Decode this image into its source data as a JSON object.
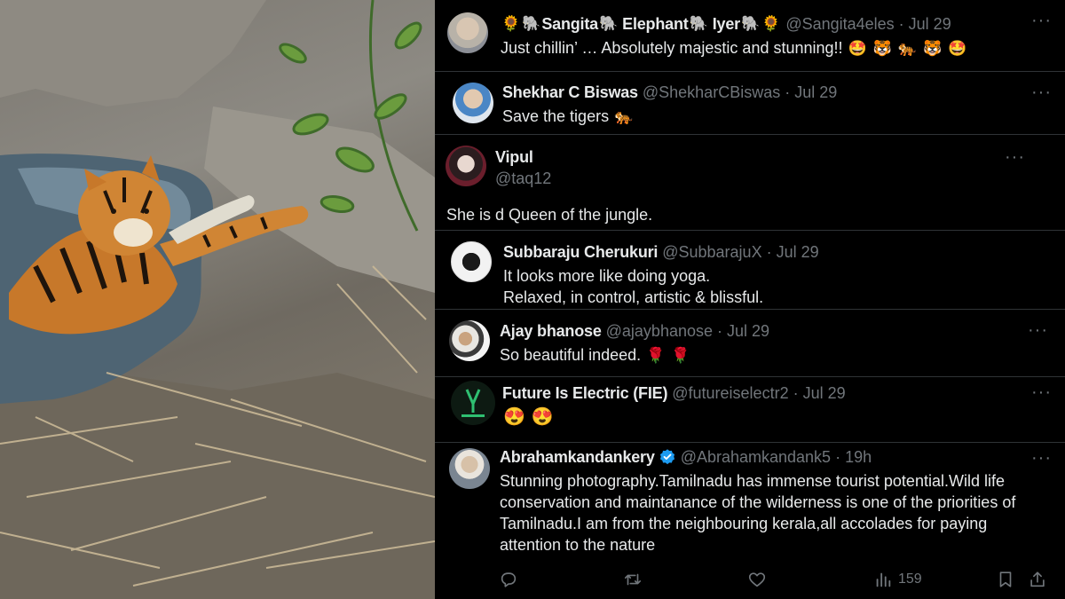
{
  "photo": {
    "subject": "tiger-in-waterhole"
  },
  "replies": [
    {
      "name_parts": [
        "Sangita",
        "Elephant",
        "Iyer"
      ],
      "name_emoji": [
        "🌻",
        "🐘",
        "🐘",
        "🐘",
        "🐘",
        "🌻"
      ],
      "handle": "@Sangita4eles",
      "time": "Jul 29",
      "text": "Just chillin’ … Absolutely majestic and stunning!!",
      "emoji": [
        "🤩",
        "🐯",
        "🐅",
        "🐯",
        "🤩"
      ]
    },
    {
      "name": "Shekhar C Biswas",
      "handle": "@ShekharCBiswas",
      "time": "Jul 29",
      "text": "Save the tigers",
      "emoji": [
        "🐅"
      ]
    },
    {
      "name": "Vipul",
      "handle": "@taq12",
      "text": "She is d Queen of the jungle."
    },
    {
      "name": "Subbaraju Cherukuri",
      "handle": "@SubbarajuX",
      "time": "Jul 29",
      "lines": [
        "It looks more like doing yoga.",
        "Relaxed, in control, artistic & blissful."
      ]
    },
    {
      "name": "Ajay bhanose",
      "handle": "@ajaybhanose",
      "time": "Jul 29",
      "text": "So beautiful indeed.",
      "emoji": [
        "🌹",
        "🌹"
      ]
    },
    {
      "name": "Future Is Electric (FIE)",
      "handle": "@futureiselectr2",
      "time": "Jul 29",
      "emoji": [
        "😍",
        "😍"
      ]
    },
    {
      "name": "Abrahamkandankery",
      "handle": "@Abrahamkandank5",
      "time": "19h",
      "lines": [
        "Stunning photography.Tamilnadu has immense tourist potential.Wild life",
        "conservation and maintanance of the wilderness is one of the priorities of",
        "Tamilnadu.I am from the neighbouring kerala,all accolades for paying",
        "attention to the nature"
      ]
    }
  ],
  "actions": {
    "views": "159"
  },
  "time_sep": "·",
  "more_glyph": "···",
  "colors": {
    "background": "#000000",
    "text": "#e7e9ea",
    "muted": "#71767b",
    "divider": "#2f3336",
    "verified": "#1d9bf0"
  },
  "icons": [
    "reply-icon",
    "retweet-icon",
    "like-icon",
    "views-icon",
    "bookmark-icon",
    "share-icon",
    "verified-badge-icon",
    "more-options-icon"
  ]
}
